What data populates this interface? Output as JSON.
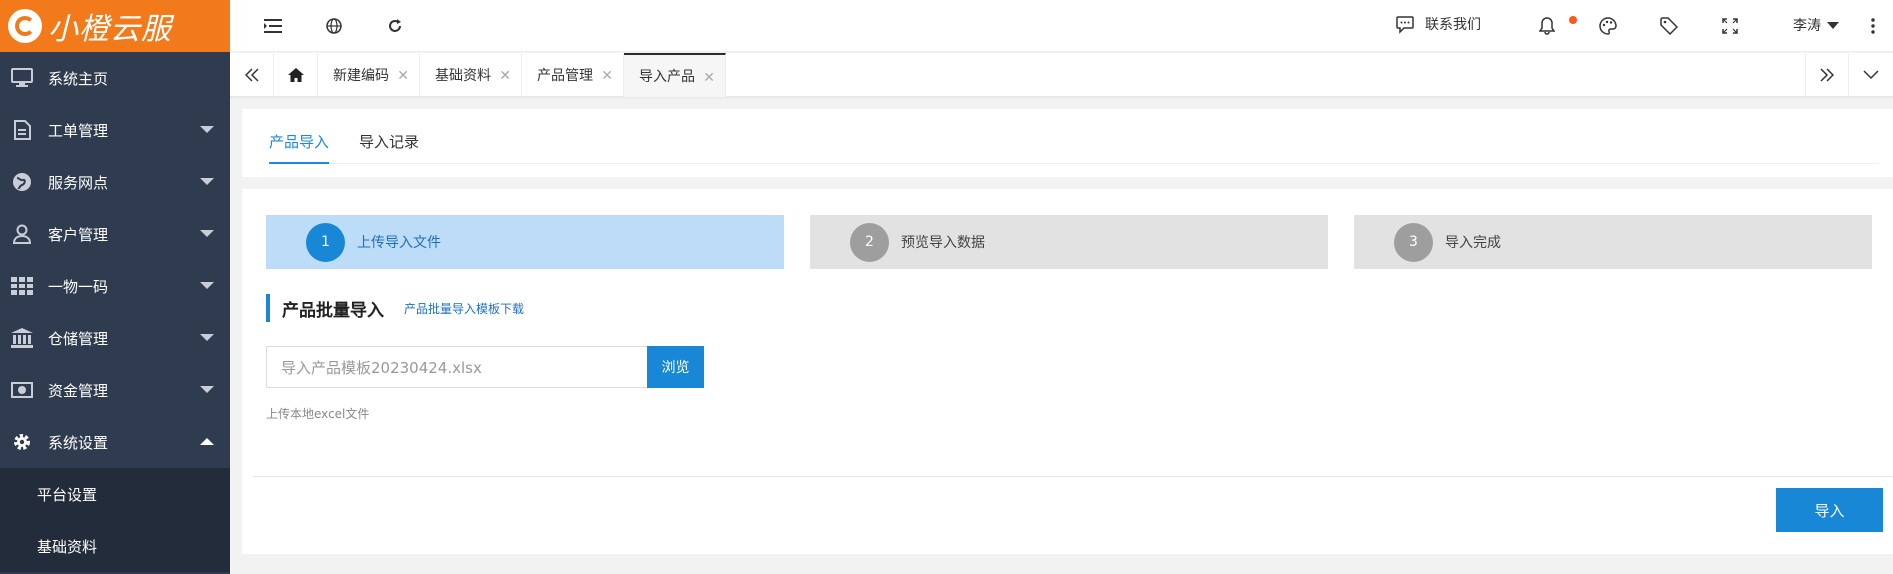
{
  "brand": {
    "name": "小橙云服",
    "color": "#f27a1a"
  },
  "sidebar": {
    "items": [
      {
        "label": "系统主页",
        "icon": "monitor-icon"
      },
      {
        "label": "工单管理",
        "icon": "document-icon"
      },
      {
        "label": "服务网点",
        "icon": "globe-icon"
      },
      {
        "label": "客户管理",
        "icon": "user-icon"
      },
      {
        "label": "一物一码",
        "icon": "grid-icon"
      },
      {
        "label": "仓储管理",
        "icon": "bank-icon"
      },
      {
        "label": "资金管理",
        "icon": "money-icon"
      },
      {
        "label": "系统设置",
        "icon": "gear-icon"
      }
    ],
    "sub_items": [
      {
        "label": "平台设置"
      },
      {
        "label": "基础资料"
      }
    ]
  },
  "topbar": {
    "contact_label": "联系我们",
    "user_name": "李涛"
  },
  "tabs": [
    {
      "label": "新建编码"
    },
    {
      "label": "基础资料"
    },
    {
      "label": "产品管理"
    },
    {
      "label": "导入产品"
    }
  ],
  "subtabs": [
    {
      "label": "产品导入"
    },
    {
      "label": "导入记录"
    }
  ],
  "steps": [
    {
      "num": "1",
      "label": "上传导入文件"
    },
    {
      "num": "2",
      "label": "预览导入数据"
    },
    {
      "num": "3",
      "label": "导入完成"
    }
  ],
  "section": {
    "title": "产品批量导入",
    "template_link": "产品批量导入模板下载",
    "file_value": "导入产品模板20230424.xlsx",
    "browse_label": "浏览",
    "hint": "上传本地excel文件",
    "import_label": "导入"
  },
  "colors": {
    "accent": "#1787d6",
    "sidebar_bg": "#2f3b4f",
    "step_active_bg": "#bcdcf7"
  }
}
